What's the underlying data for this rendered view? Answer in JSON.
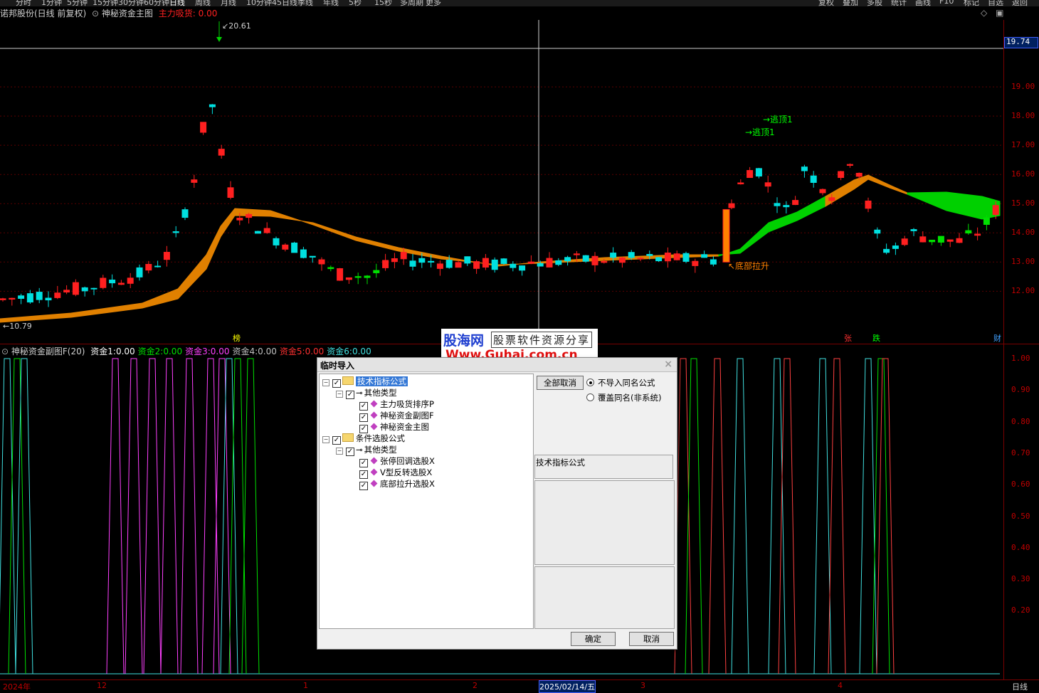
{
  "topbar": {
    "items": [
      "分时",
      "1分钟",
      "5分钟",
      "15分钟",
      "30分钟",
      "60分钟",
      "日线",
      "周线",
      "月线",
      "10分钟",
      "45日线",
      "季线",
      "年线",
      "5秒",
      "15秒",
      "多周期",
      "更多"
    ],
    "right": [
      "复权",
      "叠加",
      "多股",
      "统计",
      "画线",
      "F10",
      "标记",
      "自选",
      "返回"
    ]
  },
  "main_chart": {
    "stock": "诺邦股份(日线 前复权)",
    "indicator": "神秘资金主图",
    "signal_label": "主力吸货:",
    "signal_value": "0.00",
    "high_label": "20.61",
    "low_label": "10.79",
    "crosshair_price": "19.74",
    "price_ticks": [
      "19.00",
      "18.00",
      "17.00",
      "16.00",
      "15.00",
      "14.00",
      "13.00",
      "12.00"
    ],
    "annotations": [
      "逃顶1",
      "逃顶1",
      "底部拉升"
    ],
    "event_marks": [
      "榜",
      "张",
      "跌",
      "财"
    ]
  },
  "sub_chart": {
    "title": "神秘资金副图F(20)",
    "series": [
      {
        "label": "资金1:",
        "value": "0.00",
        "color": "#ffffff"
      },
      {
        "label": "资金2:",
        "value": "0.00",
        "color": "#00e000"
      },
      {
        "label": "资金3:",
        "value": "0.00",
        "color": "#ff40ff"
      },
      {
        "label": "资金4:",
        "value": "0.00",
        "color": "#c0c0c0"
      },
      {
        "label": "资金5:",
        "value": "0.00",
        "color": "#ff3030"
      },
      {
        "label": "资金6:",
        "value": "0.00",
        "color": "#40e0e0"
      }
    ],
    "ticks": [
      "1.00",
      "0.90",
      "0.80",
      "0.70",
      "0.60",
      "0.50",
      "0.40",
      "0.30",
      "0.20"
    ]
  },
  "date_axis": {
    "labels": [
      "2024年",
      "12",
      "1",
      "2",
      "2025/02/14/五",
      "3",
      "4"
    ],
    "period": "日线"
  },
  "watermark": {
    "brand": "股海网",
    "slogan": "股票软件资源分享",
    "url": "Www.Guhai.com.cn"
  },
  "dialog": {
    "title": "临时导入",
    "close": "×",
    "tree": [
      {
        "label": "技术指标公式",
        "level": 0,
        "kind": "folder",
        "selected": true
      },
      {
        "label": "其他类型",
        "level": 1,
        "kind": "key"
      },
      {
        "label": "主力吸货排序P",
        "level": 2,
        "kind": "item"
      },
      {
        "label": "神秘资金副图F",
        "level": 2,
        "kind": "item"
      },
      {
        "label": "神秘资金主图",
        "level": 2,
        "kind": "item"
      },
      {
        "label": "条件选股公式",
        "level": 0,
        "kind": "folder"
      },
      {
        "label": "其他类型",
        "level": 1,
        "kind": "key"
      },
      {
        "label": "张停回调选股X",
        "level": 2,
        "kind": "item"
      },
      {
        "label": "V型反转选股X",
        "level": 2,
        "kind": "item"
      },
      {
        "label": "底部拉升选股X",
        "level": 2,
        "kind": "item"
      }
    ],
    "cancel_all": "全部取消",
    "option_skip": "不导入同名公式",
    "option_overwrite": "覆盖同名(非系统)",
    "category_label": "技术指标公式",
    "ok": "确定",
    "cancel": "取消"
  }
}
